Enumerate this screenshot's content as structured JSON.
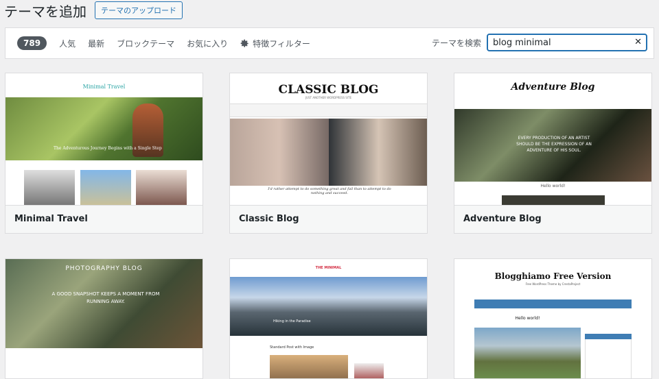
{
  "header": {
    "title": "テーマを追加",
    "upload_label": "テーマのアップロード"
  },
  "filters": {
    "count": "789",
    "popular": "人気",
    "latest": "最新",
    "block_themes": "ブロックテーマ",
    "favorites": "お気に入り",
    "feature_filter": "特徴フィルター"
  },
  "search": {
    "label": "テーマを検索",
    "value": "blog minimal"
  },
  "themes": [
    {
      "name": "Minimal Travel",
      "banner": "Minimal Travel",
      "tagline": "The Adventurous Journey Begins with a Single Step"
    },
    {
      "name": "Classic Blog",
      "banner": "CLASSIC BLOG",
      "subbanner": "JUST ANOTHER WORDPRESS SITE",
      "quote": "I'd rather attempt to do something great and fail than to attempt to do nothing and succeed."
    },
    {
      "name": "Adventure Blog",
      "banner": "Adventure Blog",
      "quote": "EVERY PRODUCTION OF AN ARTIST SHOULD BE THE EXPRESSION OF AN ADVENTURE OF HIS SOUL.",
      "hello": "Hello world!"
    },
    {
      "name": "Photography Blog",
      "banner": "PHOTOGRAPHY BLOG",
      "quote": "A GOOD SNAPSHOT KEEPS A MOMENT FROM RUNNING AWAY."
    },
    {
      "name": "The Minimal",
      "banner": "THE MINIMAL",
      "caption": "Hiking in the Paradise",
      "post": "Standard Post with Image"
    },
    {
      "name": "Blogghiamo Free Version",
      "banner": "Blogghiamo Free Version",
      "subbanner": "Free WordPress Theme by CrestaProject",
      "hello": "Hello world!"
    }
  ],
  "colors": {
    "accent": "#2271b1",
    "badge": "#50575e"
  }
}
